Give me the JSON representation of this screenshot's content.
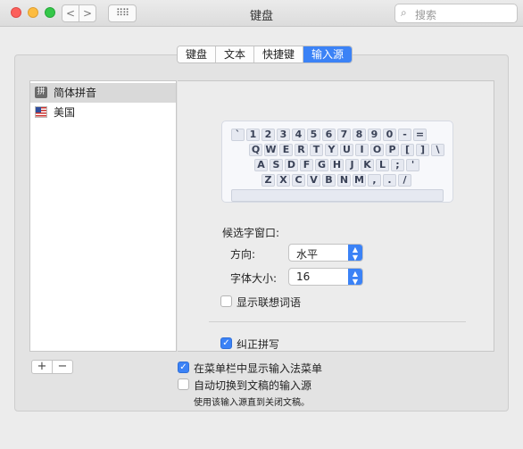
{
  "window": {
    "title": "键盘",
    "search_placeholder": "搜索",
    "back_label": "<",
    "forward_label": ">",
    "grid_label": "⠿⠿"
  },
  "tabs": [
    {
      "label": "键盘",
      "active": false
    },
    {
      "label": "文本",
      "active": false
    },
    {
      "label": "快捷键",
      "active": false
    },
    {
      "label": "输入源",
      "active": true
    }
  ],
  "input_sources": [
    {
      "label": "简体拼音",
      "icon": "pinyin-icon",
      "icon_text": "拼",
      "selected": true
    },
    {
      "label": "美国",
      "icon": "us-flag-icon",
      "selected": false
    }
  ],
  "keyboard": {
    "rows": [
      [
        "`",
        "1",
        "2",
        "3",
        "4",
        "5",
        "6",
        "7",
        "8",
        "9",
        "0",
        "-",
        "="
      ],
      [
        "Q",
        "W",
        "E",
        "R",
        "T",
        "Y",
        "U",
        "I",
        "O",
        "P",
        "[",
        "]",
        "\\"
      ],
      [
        "A",
        "S",
        "D",
        "F",
        "G",
        "H",
        "J",
        "K",
        "L",
        ";",
        "'"
      ],
      [
        "Z",
        "X",
        "C",
        "V",
        "B",
        "N",
        "M",
        ",",
        ".",
        "/"
      ]
    ]
  },
  "candidate_window": {
    "heading": "候选字窗口:",
    "direction_label": "方向:",
    "direction_value": "水平",
    "font_size_label": "字体大小:",
    "font_size_value": "16"
  },
  "options": {
    "show_predictive": {
      "label": "显示联想词语",
      "checked": false
    },
    "correct_pinyin": {
      "label": "纠正拼写",
      "checked": true
    }
  },
  "bottom": {
    "add_label": "+",
    "remove_label": "−",
    "show_menu": {
      "label": "在菜单栏中显示输入法菜单",
      "checked": true
    },
    "auto_switch": {
      "label": "自动切换到文稿的输入源",
      "checked": false
    },
    "auto_switch_note": "使用该输入源直到关闭文稿。"
  },
  "colors": {
    "accent": "#3b82f6",
    "window_bg": "#ececec"
  }
}
